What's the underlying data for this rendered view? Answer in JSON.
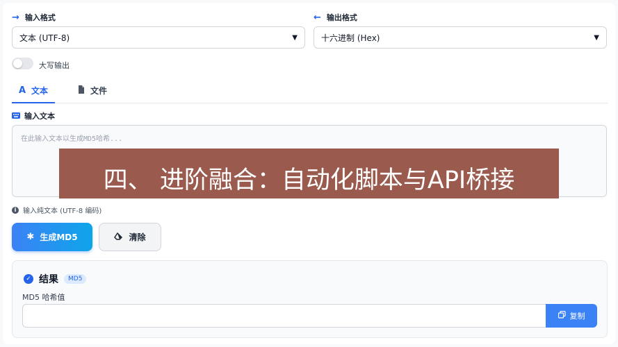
{
  "input_format": {
    "label": "输入格式",
    "selected": "文本 (UTF-8)"
  },
  "output_format": {
    "label": "输出格式",
    "selected": "十六进制 (Hex)"
  },
  "uppercase_toggle": {
    "label": "大写输出",
    "enabled": false
  },
  "tabs": [
    {
      "label": "文本",
      "icon": "text-a-icon",
      "active": true
    },
    {
      "label": "文件",
      "icon": "file-icon",
      "active": false
    }
  ],
  "text_input": {
    "label": "输入文本",
    "placeholder": "在此输入文本以生成MD5哈希...",
    "hint": "输入纯文本 (UTF-8 编码)"
  },
  "actions": {
    "generate": "生成MD5",
    "clear": "清除"
  },
  "result": {
    "title": "结果",
    "badge": "MD5",
    "hash_label": "MD5 哈希值",
    "hash_value": "",
    "copy": "复制"
  },
  "overlay": {
    "text": "四、 进阶融合：自动化脚本与API桥接"
  },
  "colors": {
    "accent": "#2563eb",
    "overlay_bg": "#9a5a4d"
  }
}
